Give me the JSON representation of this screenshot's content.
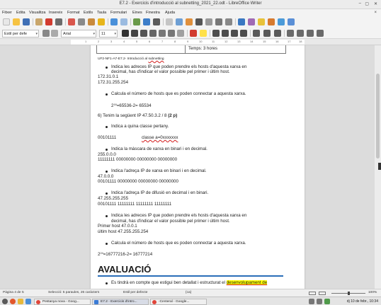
{
  "window": {
    "title": "E7.2 - Exercicis d'introducció al subnetting_2021_22.odt - LibreOffice Writer",
    "minimize": "–",
    "maximize": "▢",
    "close": "✕"
  },
  "menu": {
    "items": [
      "Fitxer",
      "Edita",
      "Visualitza",
      "Insereix",
      "Format",
      "Estils",
      "Taula",
      "Formulari",
      "Eines",
      "Finestra",
      "Ajuda"
    ],
    "close_doc": "×"
  },
  "toolbar": {
    "paragraph_style": "Estil per defe",
    "font_name": "Arial",
    "font_size": "11",
    "dropdown_arrow": "▾"
  },
  "ruler": {
    "numbers": [
      "1",
      "2",
      "3",
      "4",
      "5",
      "6",
      "7",
      "8",
      "9",
      "10",
      "11",
      "12",
      "13",
      "14",
      "15",
      "16",
      "17",
      "18"
    ]
  },
  "document": {
    "header_cell": "Temps: 3 hores",
    "header_ref_prefix": "UF2-NF1-A7-E7.2- Introducció al ",
    "header_ref_word": "subnetting",
    "bullet_hosts_a": "Indica les adreces IP que poden prendre els hosts d'aquesta xarxa en",
    "bullet_hosts_b": "decimal, has d'indicar el valor possible pel primer i últim host.",
    "ip_first_host": "172.31.0.1",
    "ip_last_host": "172.31.255.254",
    "bullet_count": "Calcula el número de hosts que es poden connectar a aquesta xarxa.",
    "calc1_base": "2",
    "calc1_exp": "16",
    "calc1_rest": "=65536-2= 65534",
    "question6_prefix": "6) Tenim la següent IP 47.50.3.2 / 8 ",
    "question6_bold": "(2 p)",
    "bullet_class": "Indica a quina classe pertany.",
    "class_bits": "00101111",
    "class_answer": "classe a=0xxxxxxx",
    "bullet_mask": "Indica la màscara de xarxa en binari i en decimal.",
    "mask_decimal": "255.0.0.0",
    "mask_binary": "11111111 00000000 00000000 00000000",
    "bullet_network": "Indica l'adreça IP de xarxa en binari i en decimal.",
    "network_decimal": "47.0.0.0",
    "network_binary": "00101111 00000000 00000000 00000000",
    "bullet_broadcast": "Indica l'adreça IP de difusió en decimal i en binari.",
    "broadcast_decimal": "47.255.255.255",
    "broadcast_binary": "00101111 11111111 11111111 11111111",
    "bullet_hosts2_a": "Indica les adreces IP que poden prendre els hosts d'aquesta xarxa en",
    "bullet_hosts2_b": "decimal, has d'indicar el valor possible pel primer i últim host.",
    "first_host": "Primer host  47.0.0.1",
    "last_host": "últim host  47.255.255.254",
    "bullet_count2": "Calcula el número de hosts que es poden connectar a aquesta xarxa.",
    "calc2_base": "2",
    "calc2_exp": "24",
    "calc2_rest": "=16777216-2= 16777214",
    "eval_heading": "AVALUACIÓ",
    "eval_bullet_prefix": "Es tindrà en compte que estigui ben detallat i estructurat el ",
    "eval_bullet_highlight": "desenvolupament de"
  },
  "statusbar": {
    "page": "Pàgina 4 de 5",
    "selection": "Selecció: 5 paraules, 26 caràcters",
    "style": "Estil per defecte",
    "language": "{ca}",
    "zoom": "100%"
  },
  "taskbar": {
    "tasks": [
      "Pestanya nova - Goog...",
      "E7.2 - Exercicis d'intro...",
      "-Centeral - Google..."
    ],
    "clock": "dj 10 de febr., 10:34"
  },
  "colors": {
    "accent_blue": "#2a6eb8",
    "highlight_yellow": "#ffff00",
    "spell_red": "#d21c1c"
  }
}
